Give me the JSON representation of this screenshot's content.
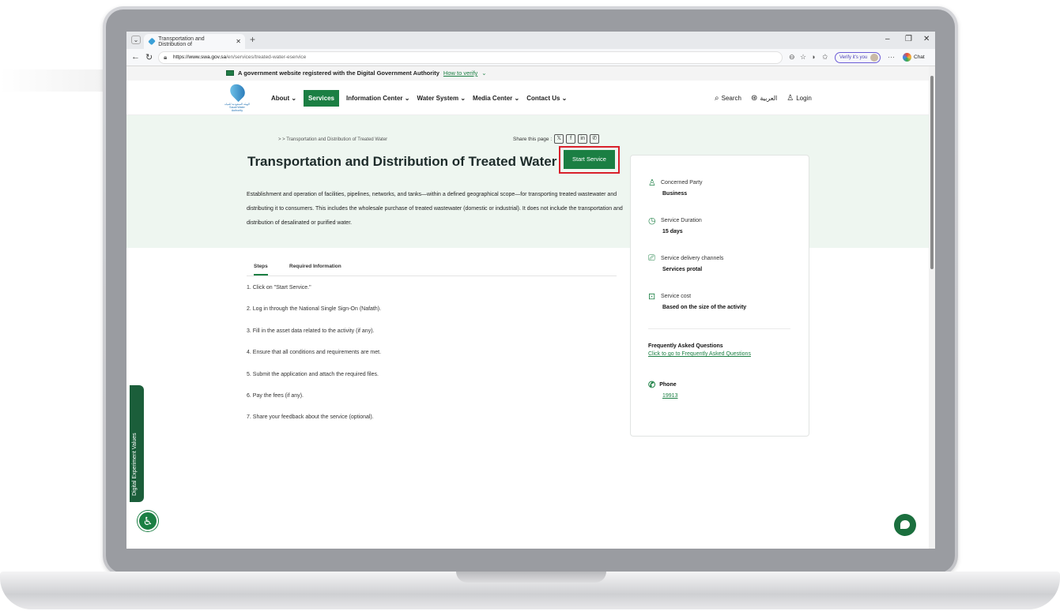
{
  "browser": {
    "tab_title": "Transportation and Distribution of",
    "url_host": "https://www.swa.gov.sa",
    "url_path": "/en/services/treated-water-eservice",
    "verify_label": "Verify it's you",
    "chat_label": "Chat"
  },
  "gov_banner": {
    "text": "A government website registered with the Digital Government Authority",
    "link": "How to verify"
  },
  "header": {
    "logo_text": "الهيئة السعودية للمياه Saudi Water Authority",
    "menu": [
      {
        "label": "About"
      },
      {
        "label": "Services"
      },
      {
        "label": "Information Center"
      },
      {
        "label": "Water System"
      },
      {
        "label": "Media Center"
      },
      {
        "label": "Contact Us"
      }
    ],
    "search": "Search",
    "language": "العربية",
    "login": "Login"
  },
  "hero": {
    "breadcrumb": ">   > Transportation and Distribution of Treated Water",
    "share_label": "Share this page :",
    "title": "Transportation and Distribution of Treated Water",
    "start_button": "Start Service",
    "description": "Establishment and operation of facilities, pipelines, networks, and tanks—within a defined geographical scope—for transporting treated wastewater and distributing it to consumers. This includes the wholesale purchase of treated wastewater (domestic or industrial). It does not include the transportation and distribution of desalinated or purified water."
  },
  "tabs": {
    "steps": "Steps",
    "required": "Required Information"
  },
  "steps": [
    "1. Click on \"Start Service.\"",
    "2. Log in through the National Single Sign-On (Nafath).",
    "3. Fill in the asset data related to the activity (if any).",
    "4. Ensure that all conditions and requirements are met.",
    "5. Submit the application and attach the required files.",
    "6. Pay the fees (if any).",
    "7. Share your feedback about the service (optional)."
  ],
  "card": {
    "party_label": "Concerned Party",
    "party_value": "Business",
    "duration_label": "Service Duration",
    "duration_value": "15 days",
    "channels_label": "Service delivery channels",
    "channels_value": "Services protal",
    "cost_label": "Service cost",
    "cost_value": "Based on the size of the activity",
    "faq_title": "Frequently Asked Questions",
    "faq_link": "Click to go to Frequently Asked Questions",
    "phone_label": "Phone",
    "phone_value": "19913"
  },
  "side_tab": "Digital Experiment Values",
  "colors": {
    "primary": "#1b7f43",
    "highlight": "#d9202b",
    "hero_bg": "#eef6f0"
  }
}
